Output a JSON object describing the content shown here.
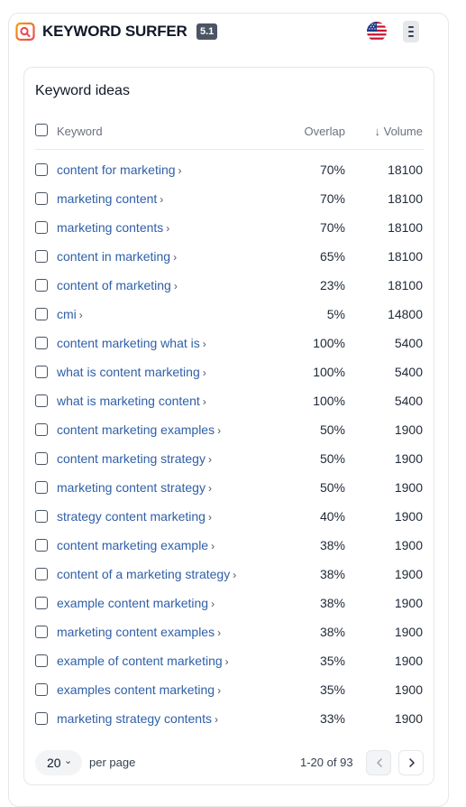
{
  "header": {
    "brand": "KEYWORD SURFER",
    "version": "5.1",
    "icons": {
      "logo": "keyword-surfer-logo",
      "flag": "us-flag-icon",
      "menu": "menu-icon"
    },
    "accent_color": "#e8484f"
  },
  "panel": {
    "title": "Keyword ideas",
    "columns": {
      "keyword": "Keyword",
      "overlap": "Overlap",
      "volume": "↓ Volume"
    },
    "rows": [
      {
        "keyword": "content for marketing",
        "overlap": "70%",
        "volume": "18100"
      },
      {
        "keyword": "marketing content",
        "overlap": "70%",
        "volume": "18100"
      },
      {
        "keyword": "marketing contents",
        "overlap": "70%",
        "volume": "18100"
      },
      {
        "keyword": "content in marketing",
        "overlap": "65%",
        "volume": "18100"
      },
      {
        "keyword": "content of marketing",
        "overlap": "23%",
        "volume": "18100"
      },
      {
        "keyword": "cmi",
        "overlap": "5%",
        "volume": "14800"
      },
      {
        "keyword": "content marketing what is",
        "overlap": "100%",
        "volume": "5400"
      },
      {
        "keyword": "what is content marketing",
        "overlap": "100%",
        "volume": "5400"
      },
      {
        "keyword": "what is marketing content",
        "overlap": "100%",
        "volume": "5400"
      },
      {
        "keyword": "content marketing examples",
        "overlap": "50%",
        "volume": "1900"
      },
      {
        "keyword": "content marketing strategy",
        "overlap": "50%",
        "volume": "1900"
      },
      {
        "keyword": "marketing content strategy",
        "overlap": "50%",
        "volume": "1900"
      },
      {
        "keyword": "strategy content marketing",
        "overlap": "40%",
        "volume": "1900"
      },
      {
        "keyword": "content marketing example",
        "overlap": "38%",
        "volume": "1900"
      },
      {
        "keyword": "content of a marketing strategy",
        "overlap": "38%",
        "volume": "1900"
      },
      {
        "keyword": "example content marketing",
        "overlap": "38%",
        "volume": "1900"
      },
      {
        "keyword": "marketing content examples",
        "overlap": "38%",
        "volume": "1900"
      },
      {
        "keyword": "example of content marketing",
        "overlap": "35%",
        "volume": "1900"
      },
      {
        "keyword": "examples content marketing",
        "overlap": "35%",
        "volume": "1900"
      },
      {
        "keyword": "marketing strategy contents",
        "overlap": "33%",
        "volume": "1900"
      }
    ],
    "pagination": {
      "per_page_value": "20",
      "per_page_label": "per page",
      "range": "1-20 of 93"
    }
  }
}
